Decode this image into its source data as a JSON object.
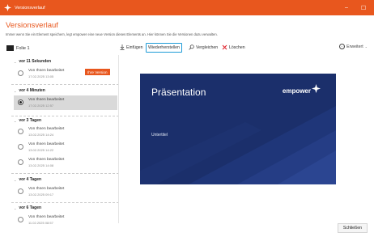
{
  "window": {
    "title": "Versionsverlauf",
    "controls": {
      "minimize": "–",
      "maximize": "☐"
    }
  },
  "header": {
    "title": "Versionsverlauf",
    "subtitle": "Immer wenn Sie ein Element speichern, legt empower eine neue Version dieses Elements an. Hier können Sie die Versionen dazu verwalten."
  },
  "toolbar": {
    "slide_label": "Folie 1",
    "insert_label": "Einfügen",
    "restore_label": "Wiederherstellen",
    "compare_label": "Vergleichen",
    "delete_label": "Löschen",
    "advanced_label": "Erweitert",
    "delete_color": "#e0262e",
    "restore_border_color": "#1e9bd7"
  },
  "groups": [
    {
      "label": "vor 11 Sekunden",
      "items": [
        {
          "name": "Von Ihnen bearbeitet",
          "date": "17.02.2025 13:05",
          "badge": "Ihre Version"
        }
      ]
    },
    {
      "label": "vor 4 Minuten",
      "items": [
        {
          "name": "Von Ihnen bearbeitet",
          "date": "17.02.2025 12:57",
          "selected": true
        }
      ]
    },
    {
      "label": "vor 3 Tagen",
      "items": [
        {
          "name": "Von Ihnen bearbeitet",
          "date": "13.02.2025 14:24"
        },
        {
          "name": "Von Ihnen bearbeitet",
          "date": "13.02.2025 14:22"
        },
        {
          "name": "Von Ihnen bearbeitet",
          "date": "13.02.2025 14:08"
        }
      ]
    },
    {
      "label": "vor 4 Tagen",
      "items": [
        {
          "name": "Von Ihnen bearbeitet",
          "date": "13.02.2025 09:17"
        }
      ]
    },
    {
      "label": "vor 6 Tagen",
      "items": [
        {
          "name": "Von Ihnen bearbeitet",
          "date": "11.02.2025 08:57"
        }
      ]
    }
  ],
  "preview": {
    "title": "Präsentation",
    "subtitle": "Untertitel",
    "logo_text": "empower",
    "background_color": "#1b2f6b"
  },
  "footer": {
    "close_label": "Schließen"
  },
  "colors": {
    "accent": "#e8571e",
    "selection": "#d9d9d9"
  }
}
